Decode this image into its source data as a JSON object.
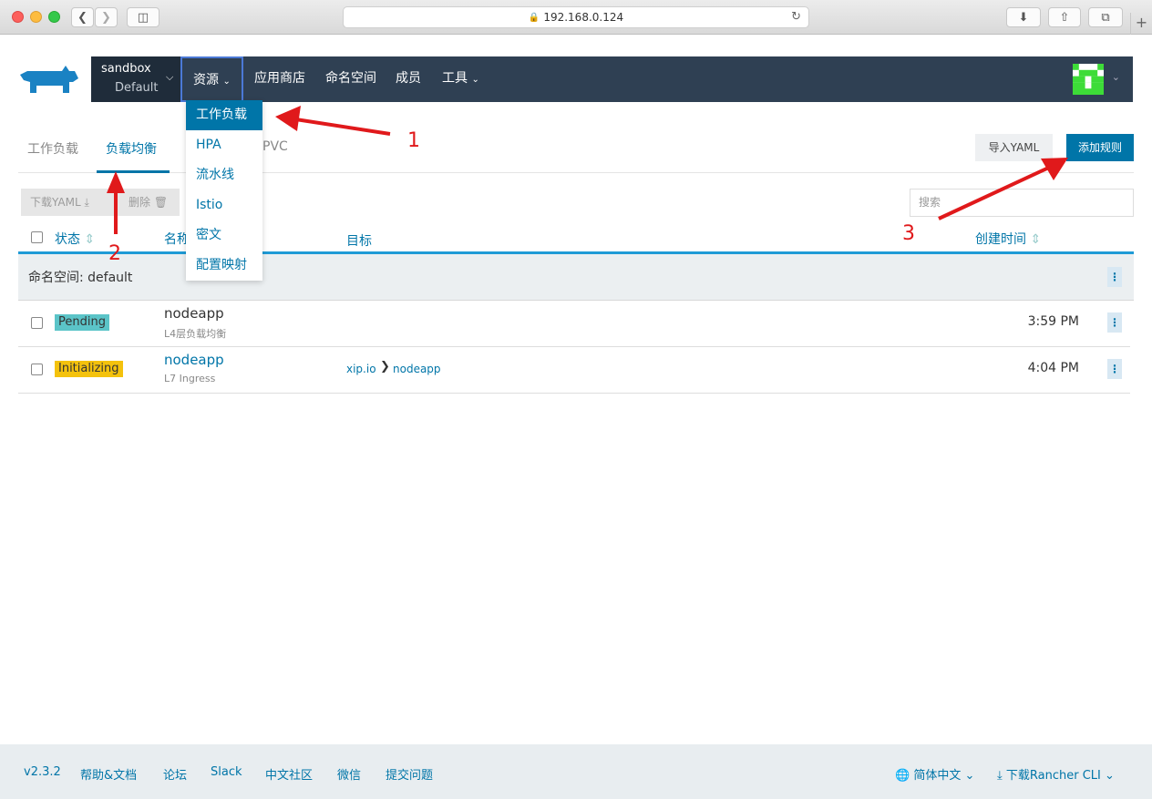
{
  "browser": {
    "url": "192.168.0.124"
  },
  "context": {
    "cluster": "sandbox",
    "project": "Default"
  },
  "nav": {
    "resources": "资源",
    "apps": "应用商店",
    "namespaces": "命名空间",
    "members": "成员",
    "tools": "工具"
  },
  "dropdown": [
    "工作负载",
    "HPA",
    "流水线",
    "Istio",
    "密文",
    "配置映射"
  ],
  "tabs": {
    "workloads": "工作负载",
    "lb": "负载均衡",
    "pvc": "PVC"
  },
  "actions": {
    "import_yaml": "导入YAML",
    "add_rule": "添加规则",
    "download_yaml": "下载YAML",
    "delete": "删除",
    "search_placeholder": "搜索"
  },
  "table": {
    "headers": {
      "state": "状态",
      "name": "名称",
      "target": "目标",
      "created": "创建时间"
    },
    "group": "命名空间: default",
    "rows": [
      {
        "state": "Pending",
        "name": "nodeapp",
        "type": "L4层负载均衡",
        "target_host": "",
        "target_svc": "",
        "time": "3:59 PM"
      },
      {
        "state": "Initializing",
        "name": "nodeapp",
        "type": "L7 Ingress",
        "target_host": "xip.io",
        "target_svc": "nodeapp",
        "time": "4:04 PM"
      }
    ]
  },
  "annotations": {
    "a1": "1",
    "a2": "2",
    "a3": "3"
  },
  "footer": {
    "version": "v2.3.2",
    "help": "帮助&文档",
    "forum": "论坛",
    "slack": "Slack",
    "cn": "中文社区",
    "wechat": "微信",
    "issue": "提交问题",
    "lang": "简体中文",
    "cli": "下载Rancher CLI"
  },
  "colors": {
    "accent": "#0075a8",
    "nav": "#2f4053",
    "pending": "#5bc4c8",
    "initializing": "#f4c20d",
    "arrow": "#e0191b"
  }
}
